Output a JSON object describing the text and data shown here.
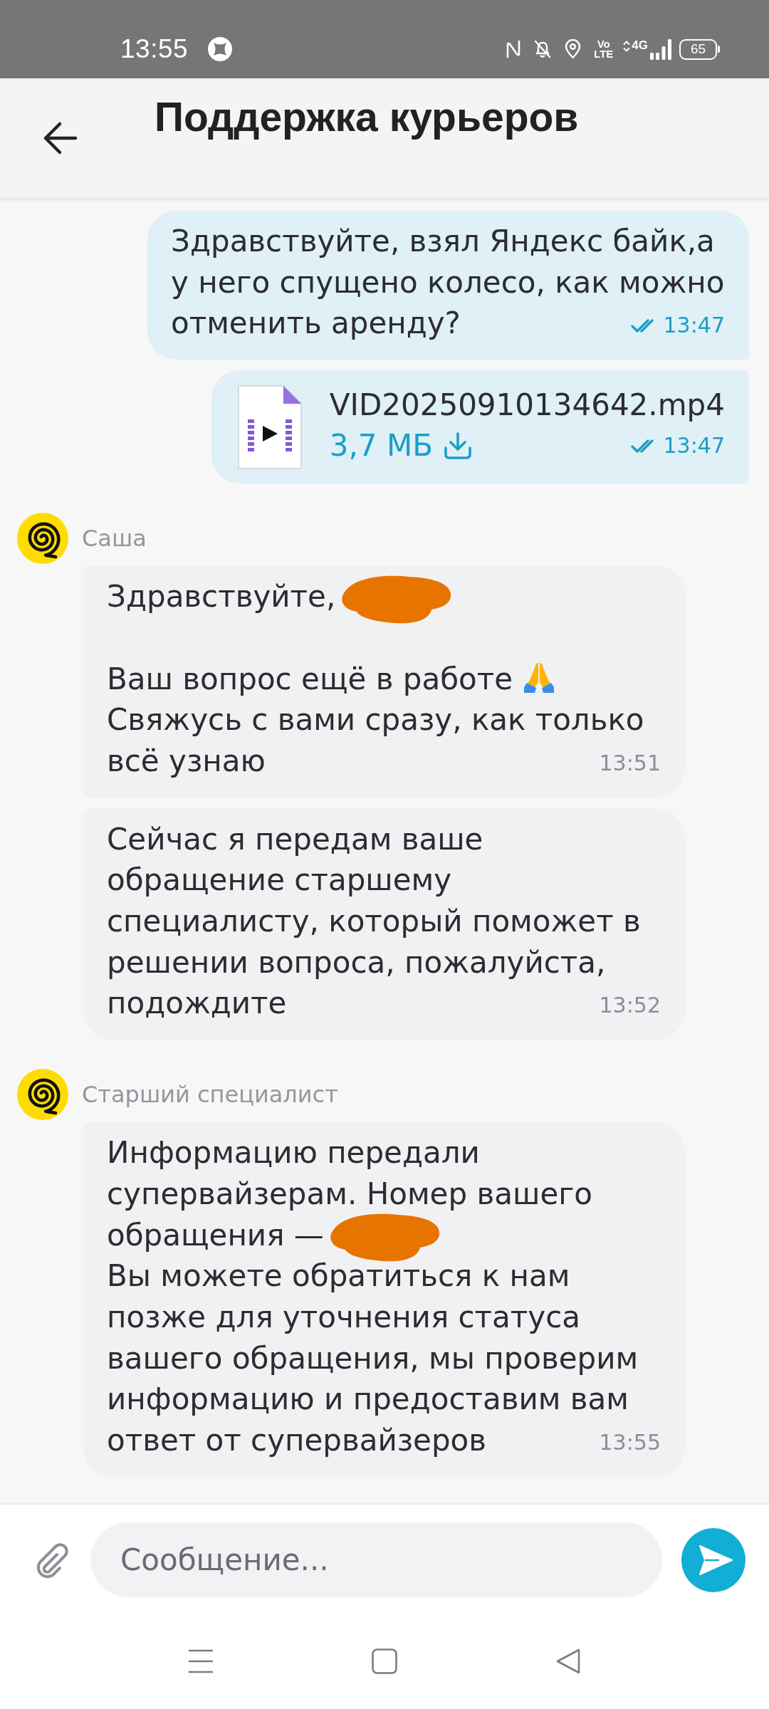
{
  "status_bar": {
    "time": "13:55",
    "volte": "Vo LTE",
    "network": "4G",
    "battery": "65"
  },
  "header": {
    "title": "Поддержка курьеров"
  },
  "groups": [
    {
      "kind": "outgoing",
      "messages": [
        {
          "kind": "text",
          "paragraphs": [
            {
              "lines": [
                {
                  "parts": [
                    {
                      "kind": "text",
                      "text": "Здравствуйте, взял Яндекс байк,а"
                    }
                  ]
                },
                {
                  "parts": [
                    {
                      "kind": "text",
                      "text": "у него спущено колесо, как можно"
                    }
                  ]
                },
                {
                  "parts": [
                    {
                      "kind": "text",
                      "text": "отменить аренду?"
                    }
                  ]
                }
              ]
            }
          ],
          "time": "13:47",
          "read": true
        },
        {
          "kind": "file",
          "file_name": "VID20250910134642.mp4",
          "size": "3,7 МБ",
          "time": "13:47",
          "read": true
        }
      ]
    },
    {
      "kind": "incoming",
      "sender": "Саша",
      "messages": [
        {
          "kind": "text",
          "paragraphs": [
            {
              "lines": [
                {
                  "parts": [
                    {
                      "kind": "text",
                      "text": "Здравствуйте,"
                    },
                    {
                      "kind": "redaction"
                    }
                  ]
                }
              ]
            },
            {
              "lines": [
                {
                  "parts": [
                    {
                      "kind": "text",
                      "text": "Ваш вопрос ещё в работе"
                    },
                    {
                      "kind": "emoji"
                    }
                  ]
                },
                {
                  "parts": [
                    {
                      "kind": "text",
                      "text": "Свяжусь с вами сразу, как только"
                    }
                  ]
                },
                {
                  "parts": [
                    {
                      "kind": "text",
                      "text": "всё узнаю"
                    }
                  ]
                }
              ]
            }
          ],
          "time": "13:51"
        },
        {
          "kind": "text",
          "paragraphs": [
            {
              "lines": [
                {
                  "parts": [
                    {
                      "kind": "text",
                      "text": "Сейчас я передам ваше"
                    }
                  ]
                },
                {
                  "parts": [
                    {
                      "kind": "text",
                      "text": "обращение старшему"
                    }
                  ]
                },
                {
                  "parts": [
                    {
                      "kind": "text",
                      "text": "специалисту, который поможет в"
                    }
                  ]
                },
                {
                  "parts": [
                    {
                      "kind": "text",
                      "text": "решении вопроса, пожалуйста,"
                    }
                  ]
                },
                {
                  "parts": [
                    {
                      "kind": "text",
                      "text": "подождите"
                    }
                  ]
                }
              ]
            }
          ],
          "time": "13:52"
        }
      ]
    },
    {
      "kind": "incoming",
      "sender": "Старший специалист",
      "messages": [
        {
          "kind": "text",
          "paragraphs": [
            {
              "lines": [
                {
                  "parts": [
                    {
                      "kind": "text",
                      "text": "Информацию передали"
                    }
                  ]
                },
                {
                  "parts": [
                    {
                      "kind": "text",
                      "text": "супервайзерам. Номер вашего"
                    }
                  ]
                },
                {
                  "parts": [
                    {
                      "kind": "text",
                      "text": "обращения —"
                    },
                    {
                      "kind": "redaction"
                    }
                  ]
                },
                {
                  "parts": [
                    {
                      "kind": "text",
                      "text": "Вы можете обратиться к нам"
                    }
                  ]
                },
                {
                  "parts": [
                    {
                      "kind": "text",
                      "text": "позже для уточнения статуса"
                    }
                  ]
                },
                {
                  "parts": [
                    {
                      "kind": "text",
                      "text": "вашего обращения, мы проверим"
                    }
                  ]
                },
                {
                  "parts": [
                    {
                      "kind": "text",
                      "text": "информацию и предоставим вам"
                    }
                  ]
                },
                {
                  "parts": [
                    {
                      "kind": "text",
                      "text": "ответ от супервайзеров"
                    }
                  ]
                }
              ]
            }
          ],
          "time": "13:55"
        }
      ]
    }
  ],
  "composer": {
    "placeholder": "Сообщение..."
  }
}
